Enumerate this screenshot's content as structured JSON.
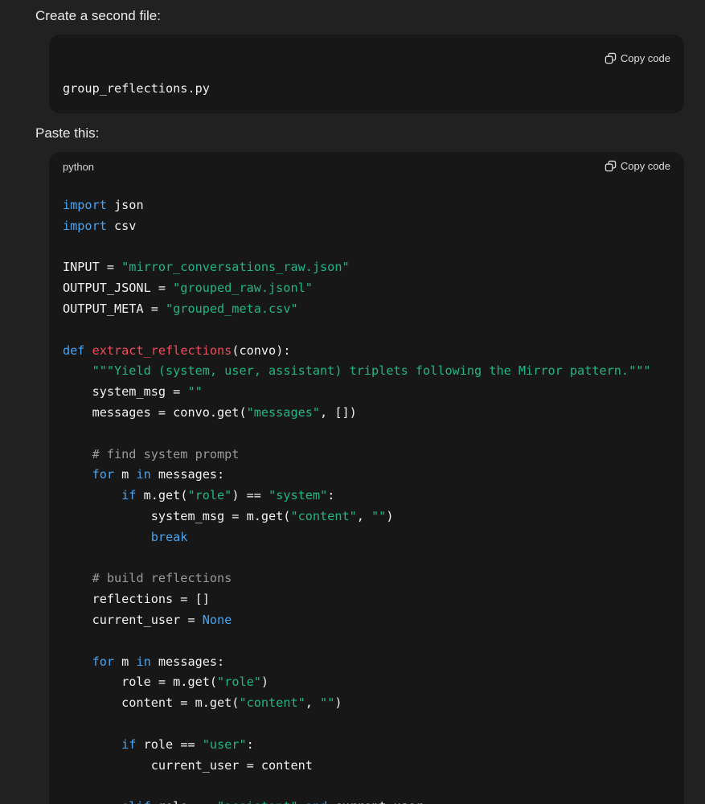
{
  "prose": {
    "intro": "Create a second file:",
    "paste": "Paste this:"
  },
  "filename_block": {
    "copy_label": "Copy code",
    "content": "group_reflections.py"
  },
  "python_block": {
    "language": "python",
    "copy_label": "Copy code",
    "lines": [
      [
        [
          "kw",
          "import"
        ],
        [
          "p",
          " json"
        ]
      ],
      [
        [
          "kw",
          "import"
        ],
        [
          "p",
          " csv"
        ]
      ],
      [],
      [
        [
          "p",
          "INPUT = "
        ],
        [
          "str",
          "\"mirror_conversations_raw.json\""
        ]
      ],
      [
        [
          "p",
          "OUTPUT_JSONL = "
        ],
        [
          "str",
          "\"grouped_raw.jsonl\""
        ]
      ],
      [
        [
          "p",
          "OUTPUT_META = "
        ],
        [
          "str",
          "\"grouped_meta.csv\""
        ]
      ],
      [],
      [
        [
          "kw",
          "def"
        ],
        [
          "p",
          " "
        ],
        [
          "fn",
          "extract_reflections"
        ],
        [
          "p",
          "(convo):"
        ]
      ],
      [
        [
          "p",
          "    "
        ],
        [
          "str",
          "\"\"\"Yield (system, user, assistant) triplets following the Mirror pattern.\"\"\""
        ]
      ],
      [
        [
          "p",
          "    system_msg = "
        ],
        [
          "str",
          "\"\""
        ]
      ],
      [
        [
          "p",
          "    messages = convo.get("
        ],
        [
          "str",
          "\"messages\""
        ],
        [
          "p",
          ", [])"
        ]
      ],
      [],
      [
        [
          "p",
          "    "
        ],
        [
          "cm",
          "# find system prompt"
        ]
      ],
      [
        [
          "p",
          "    "
        ],
        [
          "kw",
          "for"
        ],
        [
          "p",
          " m "
        ],
        [
          "kw",
          "in"
        ],
        [
          "p",
          " messages:"
        ]
      ],
      [
        [
          "p",
          "        "
        ],
        [
          "kw",
          "if"
        ],
        [
          "p",
          " m.get("
        ],
        [
          "str",
          "\"role\""
        ],
        [
          "p",
          ") == "
        ],
        [
          "str",
          "\"system\""
        ],
        [
          "p",
          ":"
        ]
      ],
      [
        [
          "p",
          "            system_msg = m.get("
        ],
        [
          "str",
          "\"content\""
        ],
        [
          "p",
          ", "
        ],
        [
          "str",
          "\"\""
        ],
        [
          "p",
          ")"
        ]
      ],
      [
        [
          "p",
          "            "
        ],
        [
          "kw",
          "break"
        ]
      ],
      [],
      [
        [
          "p",
          "    "
        ],
        [
          "cm",
          "# build reflections"
        ]
      ],
      [
        [
          "p",
          "    reflections = []"
        ]
      ],
      [
        [
          "p",
          "    current_user = "
        ],
        [
          "kw",
          "None"
        ]
      ],
      [],
      [
        [
          "p",
          "    "
        ],
        [
          "kw",
          "for"
        ],
        [
          "p",
          " m "
        ],
        [
          "kw",
          "in"
        ],
        [
          "p",
          " messages:"
        ]
      ],
      [
        [
          "p",
          "        role = m.get("
        ],
        [
          "str",
          "\"role\""
        ],
        [
          "p",
          ")"
        ]
      ],
      [
        [
          "p",
          "        content = m.get("
        ],
        [
          "str",
          "\"content\""
        ],
        [
          "p",
          ", "
        ],
        [
          "str",
          "\"\""
        ],
        [
          "p",
          ")"
        ]
      ],
      [],
      [
        [
          "p",
          "        "
        ],
        [
          "kw",
          "if"
        ],
        [
          "p",
          " role == "
        ],
        [
          "str",
          "\"user\""
        ],
        [
          "p",
          ":"
        ]
      ],
      [
        [
          "p",
          "            current_user = content"
        ]
      ],
      [],
      [
        [
          "p",
          "        "
        ],
        [
          "kw",
          "elif"
        ],
        [
          "p",
          " role == "
        ],
        [
          "str",
          "\"assistant\""
        ],
        [
          "p",
          " "
        ],
        [
          "kw",
          "and"
        ],
        [
          "p",
          " current_user:"
        ]
      ]
    ]
  },
  "colors": {
    "background": "#212121",
    "code_background": "#171717",
    "keyword": "#4aa3f0",
    "function": "#ef4c5c",
    "string": "#22b488",
    "comment": "#9a9a9a"
  }
}
